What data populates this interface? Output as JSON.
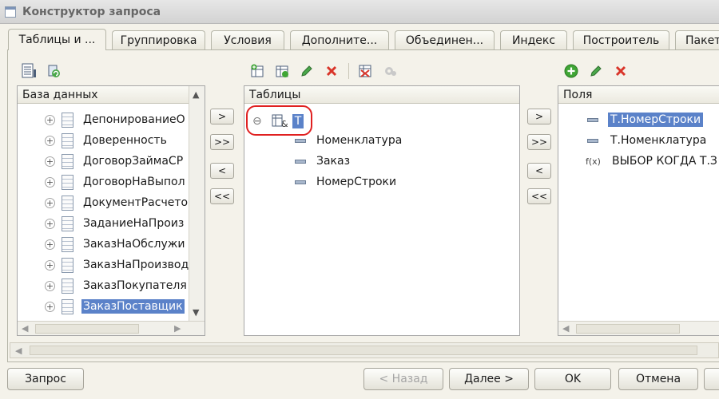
{
  "window": {
    "title": "Конструктор запроса"
  },
  "tabs": [
    {
      "label": "Таблицы и ..."
    },
    {
      "label": "Группировка"
    },
    {
      "label": "Условия"
    },
    {
      "label": "Дополните..."
    },
    {
      "label": "Объединен..."
    },
    {
      "label": "Индекс"
    },
    {
      "label": "Построитель"
    },
    {
      "label": "Пакет"
    }
  ],
  "database_panel": {
    "header": "База данных",
    "items": [
      {
        "label": "ДепонированиеО"
      },
      {
        "label": "Доверенность"
      },
      {
        "label": "ДоговорЗаймаСР"
      },
      {
        "label": "ДоговорНаВыпол"
      },
      {
        "label": "ДокументРасчето"
      },
      {
        "label": "ЗаданиеНаПроиз"
      },
      {
        "label": "ЗаказНаОбслужи"
      },
      {
        "label": "ЗаказНаПроизвод"
      },
      {
        "label": "ЗаказПокупателя"
      },
      {
        "label": "ЗаказПоставщик"
      }
    ],
    "selected_item": "ЗаказПоставщик"
  },
  "transfer_buttons": {
    "add": ">",
    "add_all": ">>",
    "remove": "<",
    "remove_all": "<<"
  },
  "tables_panel": {
    "header": "Таблицы",
    "root": {
      "expander": "⊖",
      "alias": "Т"
    },
    "fields": [
      {
        "label": "Номенклатура"
      },
      {
        "label": "Заказ"
      },
      {
        "label": "НомерСтроки"
      }
    ]
  },
  "fields_panel": {
    "header": "Поля",
    "items": [
      {
        "label": "Т.НомерСтроки",
        "selected": true
      },
      {
        "label": "Т.Номенклатура"
      },
      {
        "label": "ВЫБОР КОГДА Т.З",
        "icon_text": "f(x)"
      }
    ]
  },
  "footer": {
    "query_button": "Запрос",
    "back_button": "< Назад",
    "next_button": "Далее >",
    "ok_button": "OK",
    "cancel_button": "Отмена"
  },
  "colors": {
    "accent": "#5b82c9",
    "highlight_ring": "#e02020",
    "add_green": "#3fa535",
    "delete_red": "#d9352a"
  },
  "icons": [
    "table-list-icon",
    "add-table-icon",
    "refresh-icon",
    "edit-icon",
    "delete-icon",
    "query-table-icon",
    "gear-icon",
    "add-field-icon",
    "formula-icon"
  ]
}
